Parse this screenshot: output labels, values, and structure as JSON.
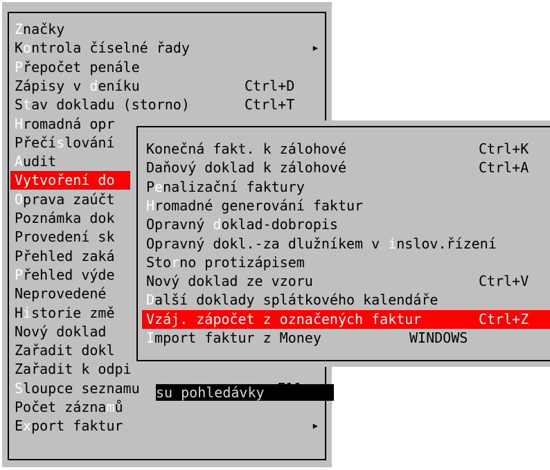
{
  "main_menu": {
    "items": [
      {
        "pre": "",
        "hk": "Z",
        "post": "načky",
        "shortcut": "",
        "submenu": false
      },
      {
        "pre": "K",
        "hk": "o",
        "post": "ntrola číselné řady",
        "shortcut": "",
        "submenu": true
      },
      {
        "pre": "",
        "hk": "P",
        "post": "řepočet penále",
        "shortcut": "",
        "submenu": false
      },
      {
        "pre": "Zápisy v ",
        "hk": "d",
        "post": "eníku",
        "shortcut": "Ctrl+D",
        "submenu": false
      },
      {
        "pre": "S",
        "hk": "t",
        "post": "av dokladu (storno)",
        "shortcut": "Ctrl+T",
        "submenu": false
      },
      {
        "pre": "",
        "hk": "H",
        "post": "romadná opr",
        "shortcut": "",
        "submenu": false
      },
      {
        "pre": "Přečí",
        "hk": "s",
        "post": "lování",
        "shortcut": "",
        "submenu": false
      },
      {
        "pre": "",
        "hk": "A",
        "post": "udit",
        "shortcut": "",
        "submenu": false
      },
      {
        "pre": "Vytvoření do",
        "hk": "",
        "post": "",
        "shortcut": "",
        "submenu": false,
        "highlight": true
      },
      {
        "pre": "",
        "hk": "O",
        "post": "prava zaúčt",
        "shortcut": "",
        "submenu": false
      },
      {
        "pre": "Poznámka dok",
        "hk": "",
        "post": "",
        "shortcut": "",
        "submenu": false
      },
      {
        "pre": "Provedení sk",
        "hk": "",
        "post": "",
        "shortcut": "",
        "submenu": false
      },
      {
        "pre": "Přehled zaká",
        "hk": "",
        "post": "",
        "shortcut": "",
        "submenu": false
      },
      {
        "pre": "",
        "hk": "P",
        "post": "řehled výde",
        "shortcut": "",
        "submenu": false
      },
      {
        "pre": "Neprovedené ",
        "hk": "",
        "post": "",
        "shortcut": "",
        "submenu": false
      },
      {
        "pre": "H",
        "hk": "i",
        "post": "storie změ",
        "shortcut": "",
        "submenu": false
      },
      {
        "pre": "Nový doklad ",
        "hk": "",
        "post": "",
        "shortcut": "",
        "submenu": false
      },
      {
        "pre": "Zařadit dokl",
        "hk": "",
        "post": "",
        "shortcut": "",
        "submenu": false
      },
      {
        "pre": "Zařadit k odpi",
        "hk": "",
        "post": "",
        "shortcut": "",
        "submenu": false
      },
      {
        "pre": "",
        "hk": "S",
        "post": "loupce seznamu",
        "shortcut": "F11",
        "submenu": false
      },
      {
        "pre": "Počet zázna",
        "hk": "m",
        "post": "ů",
        "shortcut": "",
        "submenu": false
      },
      {
        "pre": "E",
        "hk": "x",
        "post": "port faktur",
        "shortcut": "",
        "submenu": true
      }
    ],
    "tooltip": "su pohledávky"
  },
  "sub_menu": {
    "items": [
      {
        "pre": "Konečná fakt. k zálohové",
        "hk": "",
        "post": "",
        "shortcut": "Ctrl+K"
      },
      {
        "pre": "Daňový doklad k zálohové",
        "hk": "",
        "post": "",
        "shortcut": "Ctrl+A"
      },
      {
        "pre": "P",
        "hk": "e",
        "post": "nalizační faktury",
        "shortcut": ""
      },
      {
        "pre": "",
        "hk": "H",
        "post": "romadné generování faktur",
        "shortcut": ""
      },
      {
        "pre": "Opravný ",
        "hk": "d",
        "post": "oklad-dobropis",
        "shortcut": ""
      },
      {
        "pre": "Opravný dokl.-za dlužníkem v ",
        "hk": "i",
        "post": "nslov.řízení",
        "shortcut": ""
      },
      {
        "pre": "Sto",
        "hk": "r",
        "post": "no protizápisem",
        "shortcut": ""
      },
      {
        "pre": "Nový doklad ze vzoru",
        "hk": "",
        "post": "",
        "shortcut": "Ctrl+V"
      },
      {
        "pre": "",
        "hk": "D",
        "post": "alší doklady splátkového kalendáře",
        "shortcut": ""
      },
      {
        "pre": "Vzáj. zápočet z označených faktur",
        "hk": "",
        "post": "",
        "shortcut": "Ctrl+Z",
        "highlight": true
      },
      {
        "pre": "",
        "hk": "I",
        "post": "mport faktur z Money",
        "shortcut": "WINDOWS"
      }
    ]
  },
  "colors": {
    "menu_bg": "#c0c0c0",
    "highlight_bg": "#ff0000",
    "hotkey": "#ffffff"
  },
  "icons": {
    "submenu_arrow": "triangle-right-icon"
  }
}
